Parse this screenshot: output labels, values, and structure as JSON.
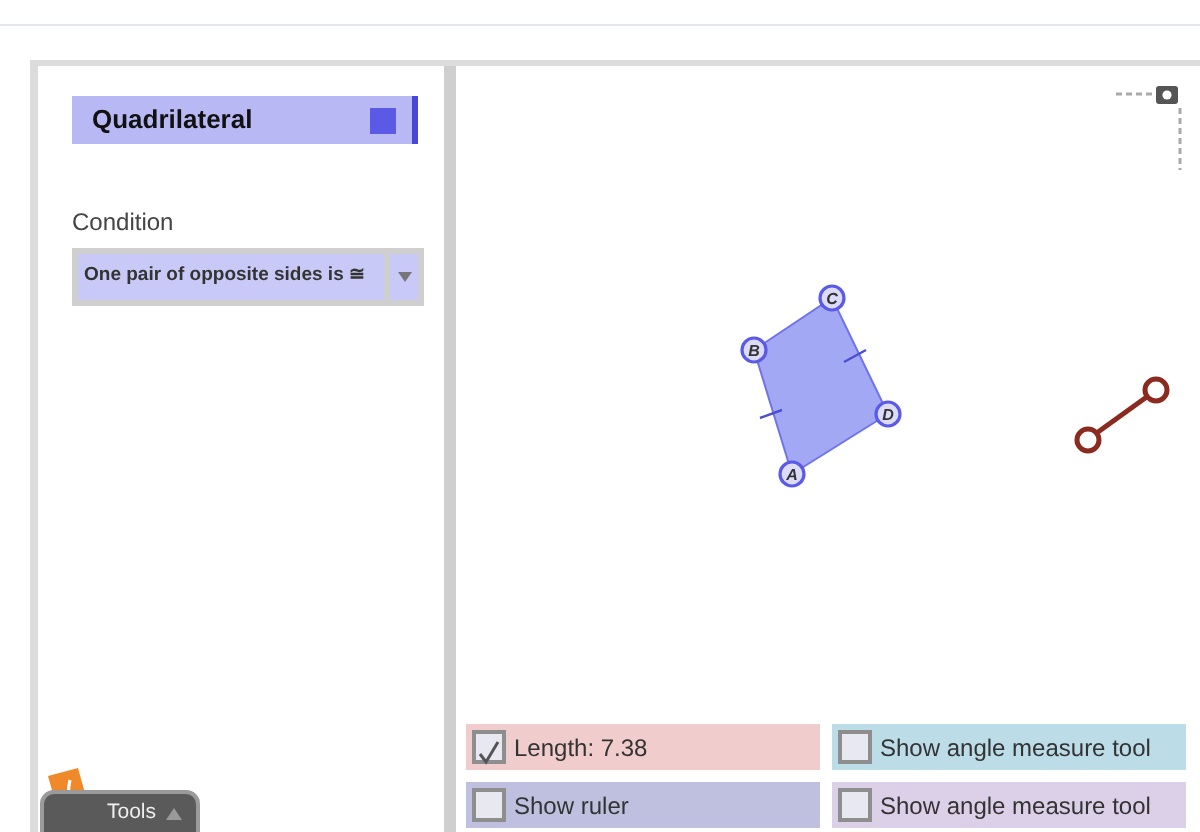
{
  "panel": {
    "title": "Quadrilateral",
    "condition_label": "Condition",
    "condition_value": "One pair of opposite sides is ≅"
  },
  "figure": {
    "points": [
      {
        "label": "A"
      },
      {
        "label": "B"
      },
      {
        "label": "C"
      },
      {
        "label": "D"
      }
    ]
  },
  "controls": [
    {
      "label": "Length: 7.38",
      "checked": true,
      "color": "#f0cccc"
    },
    {
      "label": "Show angle measure tool",
      "checked": false,
      "color": "#bcdde8"
    },
    {
      "label": "Show ruler",
      "checked": false,
      "color": "#bfc0e0"
    },
    {
      "label": "Show angle measure tool",
      "checked": false,
      "color": "#dcd0e8"
    }
  ],
  "tools": {
    "label": "Tools"
  }
}
